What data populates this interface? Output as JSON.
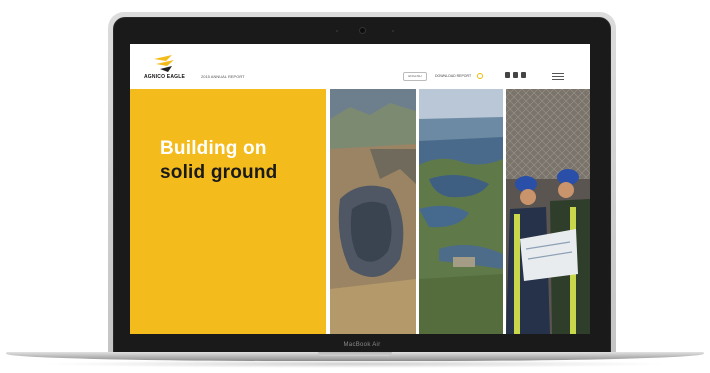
{
  "laptop": {
    "brand": "MacBook Air"
  },
  "site": {
    "logo_text": "AGNICO EAGLE",
    "report_title": "2015 ANNUAL REPORT",
    "nav_pill": "ENGLISH",
    "download_label": "DOWNLOAD REPORT",
    "social_icons": [
      "twitter-icon",
      "youtube-icon",
      "linkedin-icon"
    ],
    "menu_icon": "hamburger-menu-icon"
  },
  "hero": {
    "headline_line1": "Building on",
    "headline_line2": "solid ground",
    "accent_color": "#f4bb1c"
  },
  "photos": [
    {
      "name": "open-pit-mine-photo"
    },
    {
      "name": "lake-aerial-photo"
    },
    {
      "name": "miners-with-plans-photo"
    }
  ]
}
